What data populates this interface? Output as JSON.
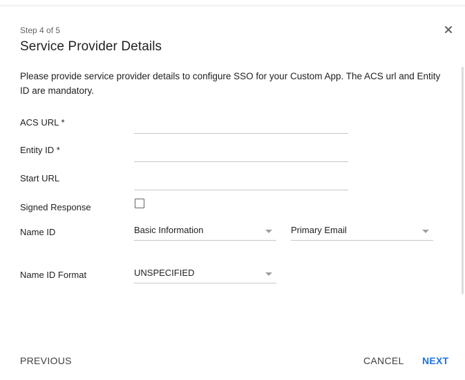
{
  "dialog": {
    "step": "Step 4 of 5",
    "title": "Service Provider Details",
    "description": "Please provide service provider details to configure SSO for your Custom App. The ACS url and Entity ID are mandatory."
  },
  "fields": {
    "acs_url": {
      "label": "ACS URL *",
      "value": ""
    },
    "entity_id": {
      "label": "Entity ID *",
      "value": ""
    },
    "start_url": {
      "label": "Start URL",
      "value": ""
    },
    "signed_response": {
      "label": "Signed Response",
      "checked": false
    },
    "name_id": {
      "label": "Name ID",
      "category": "Basic Information",
      "attribute": "Primary Email"
    },
    "name_id_format": {
      "label": "Name ID Format",
      "value": "UNSPECIFIED"
    }
  },
  "footer": {
    "previous_label": "PREVIOUS",
    "cancel_label": "CANCEL",
    "next_label": "NEXT"
  },
  "colors": {
    "primary": "#1a73e8",
    "text": "#202124",
    "secondary_text": "#5f6368",
    "divider": "#c4c7c5"
  },
  "icons": {
    "close": "close-icon",
    "dropdown": "triangle-down-icon",
    "checkbox": "checkbox-unchecked"
  }
}
